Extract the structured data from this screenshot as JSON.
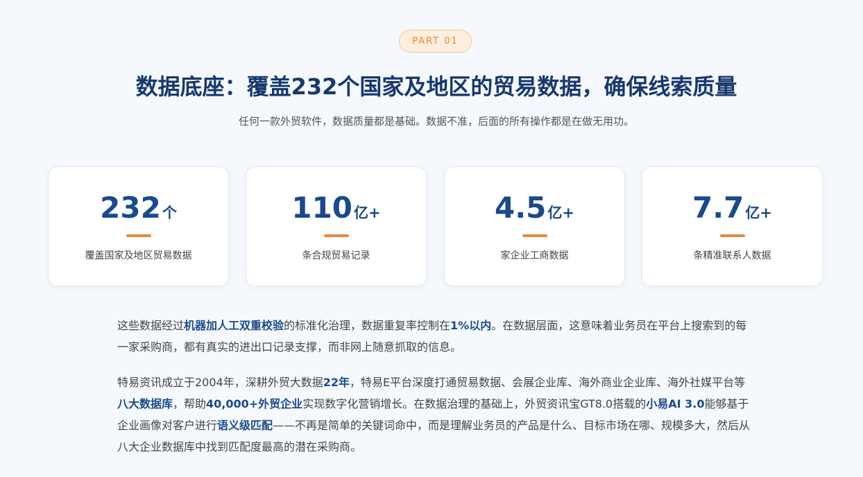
{
  "header": {
    "badge": "PART 01",
    "title": "数据底座：覆盖232个国家及地区的贸易数据，确保线索质量",
    "subtitle": "任何一款外贸软件，数据质量都是基础。数据不准，后面的所有操作都是在做无用功。"
  },
  "stats": [
    {
      "value": "232",
      "unit": "个",
      "label": "覆盖国家及地区贸易数据"
    },
    {
      "value": "110",
      "unit": "亿+",
      "label": "条合规贸易记录"
    },
    {
      "value": "4.5",
      "unit": "亿+",
      "label": "家企业工商数据"
    },
    {
      "value": "7.7",
      "unit": "亿+",
      "label": "条精准联系人数据"
    }
  ],
  "accent_color": "#e8883a",
  "primary_color": "#1a4a8d",
  "paragraph1": {
    "t1": "这些数据经过",
    "b1": "机器加人工双重校验",
    "t2": "的标准化治理，数据重复率控制在",
    "b2": "1%以内",
    "t3": "。在数据层面，这意味着业务员在平台上搜索到的每一家采购商，都有真实的进出口记录支撑，而非网上随意抓取的信息。"
  },
  "paragraph2": {
    "t1": "特易资讯成立于2004年，深耕外贸大数据",
    "b1": "22年",
    "t2": "，特易E平台深度打通贸易数据、会展企业库、海外商业企业库、海外社媒平台等",
    "b2": "八大数据库",
    "t3": "，帮助",
    "b3": "40,000+外贸企业",
    "t4": "实现数字化营销增长。在数据治理的基础上，外贸资讯宝GT8.0搭载的",
    "b4": "小易AI 3.0",
    "t5": "能够基于企业画像对客户进行",
    "b5": "语义级匹配",
    "t6": "——不再是简单的关键词命中，而是理解业务员的产品是什么、目标市场在哪、规模多大，然后从八大企业数据库中找到匹配度最高的潜在采购商。"
  }
}
